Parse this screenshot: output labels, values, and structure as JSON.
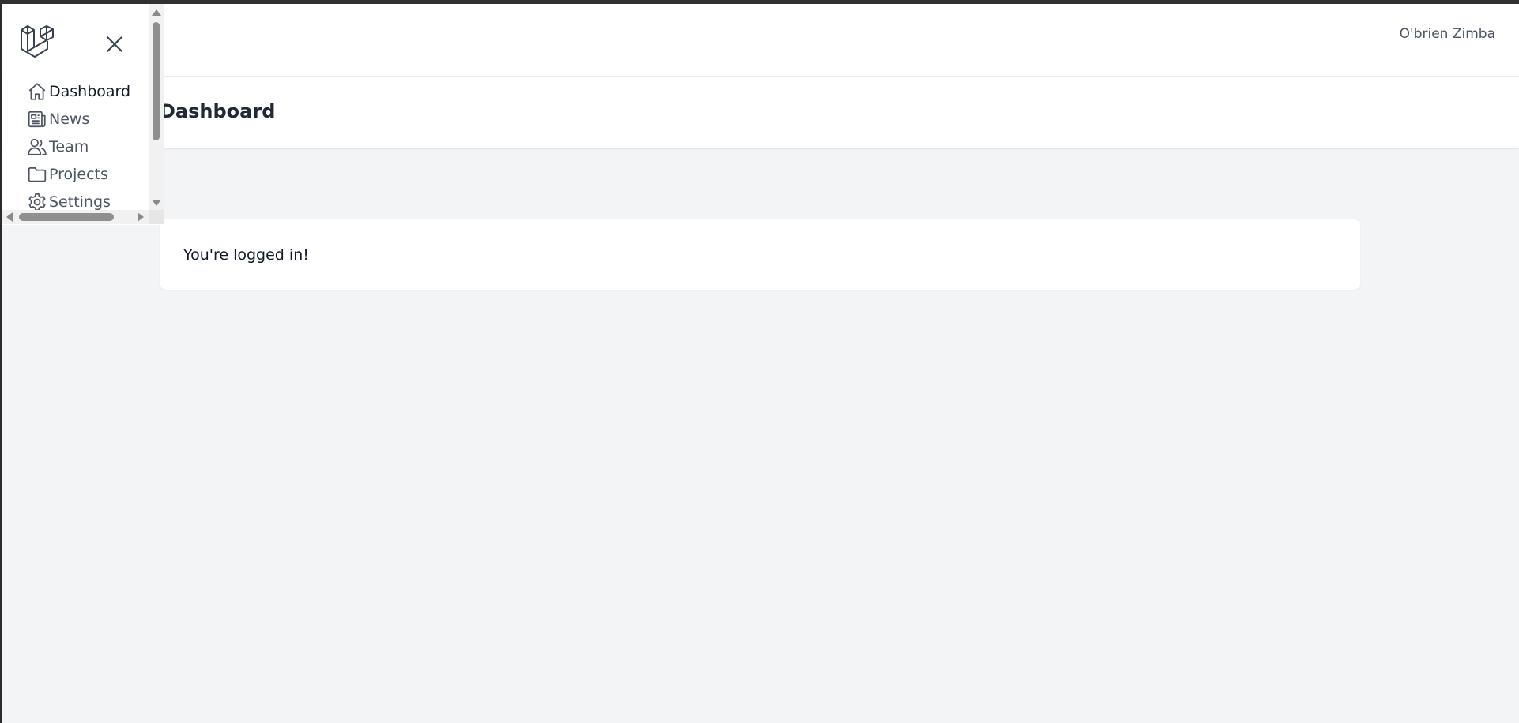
{
  "app": {
    "user_name": "O'brien Zimba"
  },
  "header": {
    "title": "Dashboard"
  },
  "main": {
    "card_text": "You're logged in!"
  },
  "sidebar": {
    "logo_icon": "laravel-logo-icon",
    "close_icon": "close-icon",
    "items": [
      {
        "label": "Dashboard",
        "icon": "home-icon",
        "active": true
      },
      {
        "label": "News",
        "icon": "newspaper-icon",
        "active": false
      },
      {
        "label": "Team",
        "icon": "users-icon",
        "active": false
      },
      {
        "label": "Projects",
        "icon": "folder-icon",
        "active": false
      },
      {
        "label": "Settings",
        "icon": "gear-icon",
        "active": false
      }
    ]
  },
  "colors": {
    "page_background": "#f3f4f6",
    "surface": "#ffffff",
    "text_primary": "#111827",
    "text_secondary": "#4b5563",
    "scrollbar_thumb": "#8f8f8f"
  }
}
